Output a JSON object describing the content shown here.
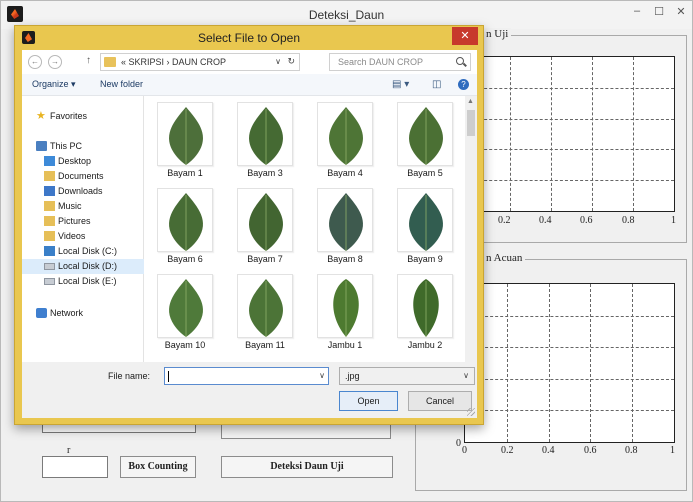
{
  "main_window": {
    "title": "Deteksi_Daun",
    "controls": {
      "minimize": "–",
      "maximize": "☐",
      "close": "✕"
    }
  },
  "panels": {
    "uji_title": "n Uji",
    "acuan_title": "n Acuan"
  },
  "axes_uji": {
    "x_ticks": [
      "0.2",
      "0.4",
      "0.6",
      "0.8",
      "1"
    ]
  },
  "axes_acuan": {
    "x_ticks": [
      "0",
      "0.2",
      "0.4",
      "0.6",
      "0.8",
      "1"
    ],
    "y_ticks": [
      "0"
    ]
  },
  "background_controls": {
    "small_label": "r",
    "box_counting_label": "Box Counting",
    "deteksi_label": "Deteksi Daun Uji"
  },
  "dialog": {
    "title": "Select File to Open",
    "close_glyph": "✕",
    "address": {
      "path": "« SKRIPSI  ›  DAUN CROP",
      "search_placeholder": "Search DAUN CROP",
      "back": "←",
      "forward": "→",
      "up": "↑",
      "dropdown": "∨",
      "refresh": "↻"
    },
    "toolbar": {
      "organize": "Organize ▾",
      "new_folder": "New folder",
      "view_icon": "▤ ▾",
      "pane_icon": "◫",
      "help_icon": "?"
    },
    "nav": {
      "favorites": "Favorites",
      "this_pc": "This PC",
      "items": [
        "Desktop",
        "Documents",
        "Downloads",
        "Music",
        "Pictures",
        "Videos",
        "Local Disk (C:)",
        "Local Disk (D:)",
        "Local Disk (E:)"
      ],
      "network": "Network",
      "selected": "Local Disk (D:)"
    },
    "files": [
      {
        "name": "Bayam 1",
        "color": "#4d6f3a",
        "kind": "bayam"
      },
      {
        "name": "Bayam 3",
        "color": "#456a33",
        "kind": "bayam"
      },
      {
        "name": "Bayam 4",
        "color": "#4e7536",
        "kind": "bayam"
      },
      {
        "name": "Bayam 5",
        "color": "#4b7034",
        "kind": "bayam"
      },
      {
        "name": "Bayam 6",
        "color": "#476c35",
        "kind": "bayam"
      },
      {
        "name": "Bayam 7",
        "color": "#426531",
        "kind": "bayam"
      },
      {
        "name": "Bayam 8",
        "color": "#3e5a4e",
        "kind": "bayam"
      },
      {
        "name": "Bayam 9",
        "color": "#325d50",
        "kind": "bayam"
      },
      {
        "name": "Bayam 10",
        "color": "#4f7a3a",
        "kind": "bayam"
      },
      {
        "name": "Bayam 11",
        "color": "#4c7437",
        "kind": "bayam"
      },
      {
        "name": "Jambu 1",
        "color": "#4d7a30",
        "kind": "jambu"
      },
      {
        "name": "Jambu 2",
        "color": "#3f6a2a",
        "kind": "jambu"
      }
    ],
    "file_name_label": "File name:",
    "file_name_value": "",
    "file_type": ".jpg",
    "open_label": "Open",
    "cancel_label": "Cancel"
  }
}
